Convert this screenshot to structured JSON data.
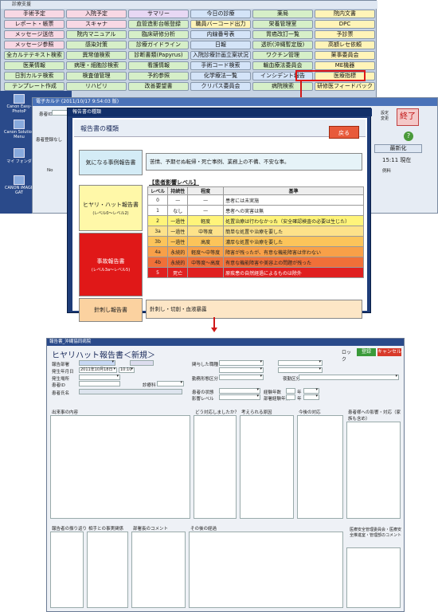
{
  "top_window": {
    "title": "診療支援",
    "menu": [
      {
        "label": "手術予定",
        "color": "pink"
      },
      {
        "label": "入院予定",
        "color": "pink"
      },
      {
        "label": "サマリー",
        "color": "purple"
      },
      {
        "label": "今日の診療",
        "color": "blue"
      },
      {
        "label": "薬局",
        "color": "green"
      },
      {
        "label": "院内文書",
        "color": "yellow"
      },
      {
        "label": "レポート・帳票",
        "color": "pink"
      },
      {
        "label": "スキャナ",
        "color": "pink"
      },
      {
        "label": "血管造影台帳登録",
        "color": "green"
      },
      {
        "label": "職員バーコード出力",
        "color": "yellow"
      },
      {
        "label": "栄養管理室",
        "color": "green"
      },
      {
        "label": "DPC",
        "color": "yellow"
      },
      {
        "label": "メッセージ送信",
        "color": "pink"
      },
      {
        "label": "院内マニュアル",
        "color": "green"
      },
      {
        "label": "臨床研修分析",
        "color": "green"
      },
      {
        "label": "内線番号表",
        "color": "blue"
      },
      {
        "label": "胃癌改訂一覧",
        "color": "green"
      },
      {
        "label": "予診票",
        "color": "yellow"
      },
      {
        "label": "メッセージ参照",
        "color": "pink"
      },
      {
        "label": "感染対策",
        "color": "green"
      },
      {
        "label": "診療ガイドライン",
        "color": "green"
      },
      {
        "label": "日報",
        "color": "blue"
      },
      {
        "label": "透析(沖縄暫定版)",
        "color": "green"
      },
      {
        "label": "高額レセ依頼",
        "color": "yellow"
      },
      {
        "label": "全カルテテキスト検索",
        "color": "green"
      },
      {
        "label": "異常値検索",
        "color": "green"
      },
      {
        "label": "診断書類(Papyrus)",
        "color": "green"
      },
      {
        "label": "入院診療計画立案状況",
        "color": "blue"
      },
      {
        "label": "ワクチン管理",
        "color": "green"
      },
      {
        "label": "薬事委員会",
        "color": "yellow"
      },
      {
        "label": "医薬情報",
        "color": "green"
      },
      {
        "label": "病理・細胞診検索",
        "color": "green"
      },
      {
        "label": "看護情報",
        "color": "green"
      },
      {
        "label": "手術コード検索",
        "color": "blue"
      },
      {
        "label": "輸血療法委員会",
        "color": "green"
      },
      {
        "label": "ME機器",
        "color": "yellow"
      },
      {
        "label": "日別カルテ検索",
        "color": "green"
      },
      {
        "label": "検査値管理",
        "color": "green"
      },
      {
        "label": "予約参照",
        "color": "green"
      },
      {
        "label": "化学療法一覧",
        "color": "blue"
      },
      {
        "label": "インシデント報告",
        "color": "blue"
      },
      {
        "label": "医療指標",
        "color": "yellow"
      },
      {
        "label": "テンプレート作成",
        "color": "green"
      },
      {
        "label": "リハビリ",
        "color": "green"
      },
      {
        "label": "改善要望書",
        "color": "green"
      },
      {
        "label": "クリパス委員会",
        "color": "blue"
      },
      {
        "label": "病院検索",
        "color": "green"
      },
      {
        "label": "研修医フィードバック",
        "color": "yellow"
      }
    ]
  },
  "desktop": {
    "icons": [
      "Canon Easy-PhotoP",
      "Canon Solution Menu",
      "マイ フォンダ",
      "CANON iMAGE GAT"
    ]
  },
  "karte": {
    "title": "電子カルテ (2011/10/17 9:54:03 版)",
    "id_label": "患者ID",
    "register_label": "患者登録なし",
    "col_no": "No",
    "end_label": "終了",
    "settings_label": "設定変更",
    "help_label": "?",
    "refresh_label": "最新化",
    "time_now": "15:11 現在",
    "example_label": "例料"
  },
  "modal": {
    "title": "報告書の種類",
    "heading": "報告書の種類",
    "back_label": "戻る",
    "categories": [
      {
        "label": "気になる事例報告書",
        "sub": ""
      },
      {
        "label": "ヒヤリ・ハット報告書",
        "sub": "(レベル0〜レベル2)"
      },
      {
        "label": "事故報告書",
        "sub": "(レベル3a〜レベル5)"
      },
      {
        "label": "針刺し報告書",
        "sub": ""
      }
    ],
    "cat1_desc": "苦情、予期せぬ転帰・死亡事例、業務上の不備、不安な事。",
    "table_title": "【患者影響レベル】",
    "table_headers": [
      "レベル",
      "持続性",
      "程度",
      "基準"
    ],
    "levels": [
      {
        "level": "0",
        "dur": "—",
        "deg": "—",
        "desc": "患者には未実施",
        "color": "#ffffff"
      },
      {
        "level": "1",
        "dur": "なし",
        "deg": "—",
        "desc": "患者への実害は無",
        "color": "#ffffff"
      },
      {
        "level": "2",
        "dur": "一過性",
        "deg": "軽度",
        "desc": "処置治療は行わなかった（安全確認検査の必要は生じた）",
        "color": "#fff47a"
      },
      {
        "level": "3a",
        "dur": "一過性",
        "deg": "中等度",
        "desc": "簡単な処置や治療を要した",
        "color": "#fde28a"
      },
      {
        "level": "3b",
        "dur": "一過性",
        "deg": "高度",
        "desc": "濃厚な処置や治療を要した",
        "color": "#fcc45a"
      },
      {
        "level": "4a",
        "dur": "永続的",
        "deg": "軽度〜中等度",
        "desc": "障害が残ったが、有意な機能障害は伴わない",
        "color": "#f8a048"
      },
      {
        "level": "4b",
        "dur": "永続的",
        "deg": "中等度〜高度",
        "desc": "有意な機能障害や美容上の問題が残った",
        "color": "#f07038"
      },
      {
        "level": "5",
        "dur": "死亡",
        "deg": "",
        "desc": "原疾患の自然経過によるものは除外",
        "color": "#e02020"
      }
    ],
    "cat4_desc": "針刺し・切創・血液暴露"
  },
  "form": {
    "window_title": "報告書_沖縄協同病院",
    "title": "ヒヤリハット報告書＜新規＞",
    "save_label": "登録",
    "cancel_label": "キャンセル",
    "lock_label": "ロック",
    "fields_left": [
      {
        "label": "報告部署",
        "value": ""
      },
      {
        "label": "発生年月日",
        "value": "2011年10月18日"
      },
      {
        "label": "発生場所",
        "value": ""
      },
      {
        "label": "患者ID",
        "value": ""
      },
      {
        "label": "患者氏名",
        "value": ""
      }
    ],
    "time_value": "10:10",
    "dept_label": "診療科",
    "fields_mid": [
      {
        "label": "関与した職種"
      },
      {
        "label": "勤務形態区分"
      },
      {
        "label": "患者の状態"
      },
      {
        "label": "影響レベル"
      }
    ],
    "exp_label": "経験年数",
    "exp_unit": "年",
    "work_label": "部署経験年数",
    "shift_label": "夜勤区分",
    "sections_top": [
      "出来事の内容",
      "どう対応しましたか？",
      "考えられる原因",
      "今後の対応",
      "患者様への影響・対応（家族も含め）"
    ],
    "sections_bottom": [
      "報告者の振り返り",
      "相手との事実関係",
      "部署長のコメント",
      "その後の経過",
      "医療安全管理委員会・医療安全推進室・管理部のコメント"
    ]
  }
}
